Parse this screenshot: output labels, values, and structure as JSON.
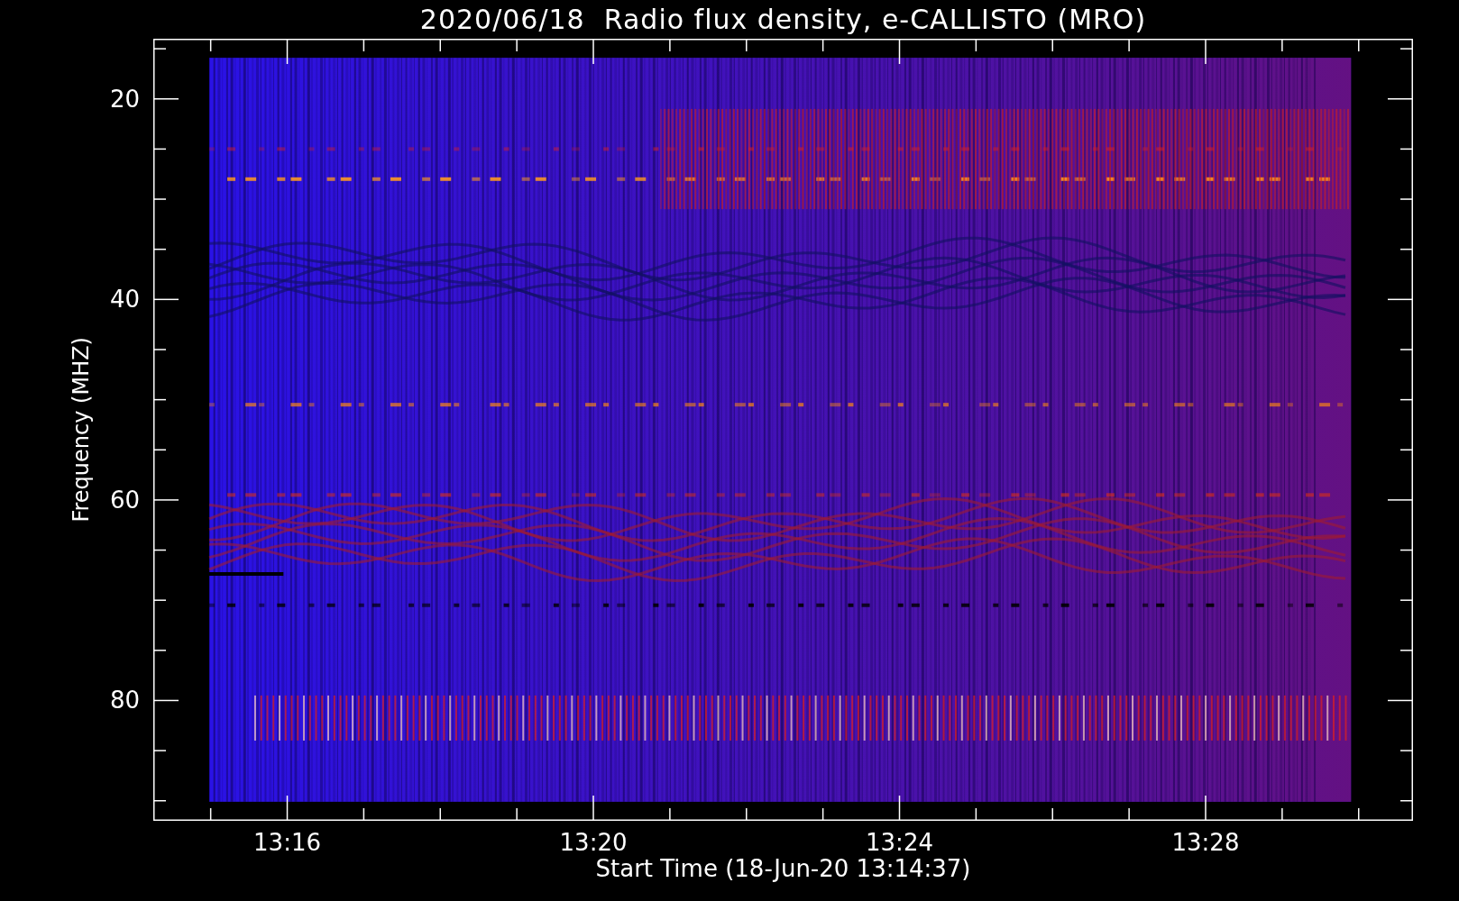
{
  "title": "2020/06/18  Radio flux density, e-CALLISTO (MRO)",
  "spectrogram": {
    "ylabel": "Frequency (MHZ)",
    "xlabel": "Start Time (18-Jun-20 13:14:37)",
    "yticks": [
      "20",
      "40",
      "60",
      "80"
    ],
    "xticks": [
      "13:16",
      "13:20",
      "13:24",
      "13:28"
    ]
  }
}
